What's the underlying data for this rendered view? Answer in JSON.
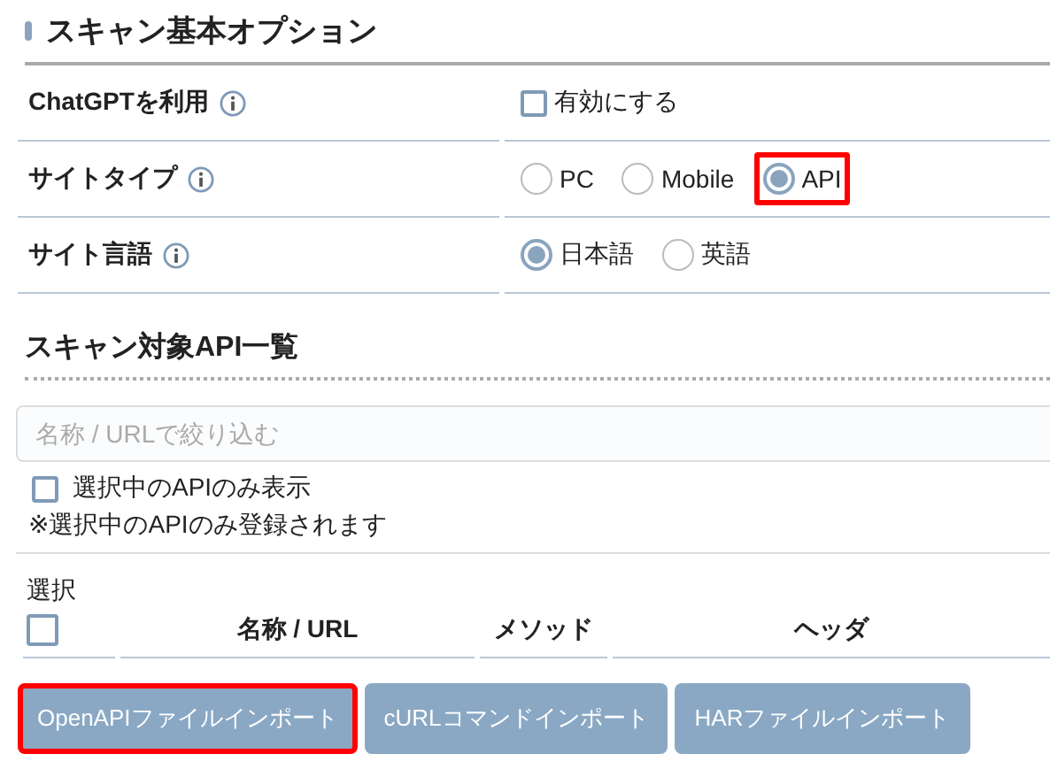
{
  "basic_options": {
    "title": "スキャン基本オプション",
    "rows": [
      {
        "label": "ChatGPTを利用",
        "kind": "checkbox",
        "options": [
          {
            "label": "有効にする",
            "checked": false,
            "highlighted": false
          }
        ]
      },
      {
        "label": "サイトタイプ",
        "kind": "radio",
        "options": [
          {
            "label": "PC",
            "selected": false,
            "highlighted": false
          },
          {
            "label": "Mobile",
            "selected": false,
            "highlighted": false
          },
          {
            "label": "API",
            "selected": true,
            "highlighted": true
          }
        ]
      },
      {
        "label": "サイト言語",
        "kind": "radio",
        "options": [
          {
            "label": "日本語",
            "selected": true,
            "highlighted": false
          },
          {
            "label": "英語",
            "selected": false,
            "highlighted": false
          }
        ]
      }
    ]
  },
  "api_list": {
    "title": "スキャン対象API一覧",
    "filter": {
      "placeholder": "名称 / URLで絞り込む"
    },
    "only_selected": {
      "label": "選択中のAPIのみ表示",
      "checked": false
    },
    "note": "※選択中のAPIのみ登録されます",
    "table": {
      "select_column": {
        "label": "選択",
        "checked": false
      },
      "columns": [
        "名称 / URL",
        "メソッド",
        "ヘッダ"
      ]
    },
    "buttons": [
      {
        "label": "OpenAPIファイルインポート",
        "highlighted": true
      },
      {
        "label": "cURLコマンドインポート",
        "highlighted": false
      },
      {
        "label": "HARファイルインポート",
        "highlighted": false
      }
    ]
  }
}
